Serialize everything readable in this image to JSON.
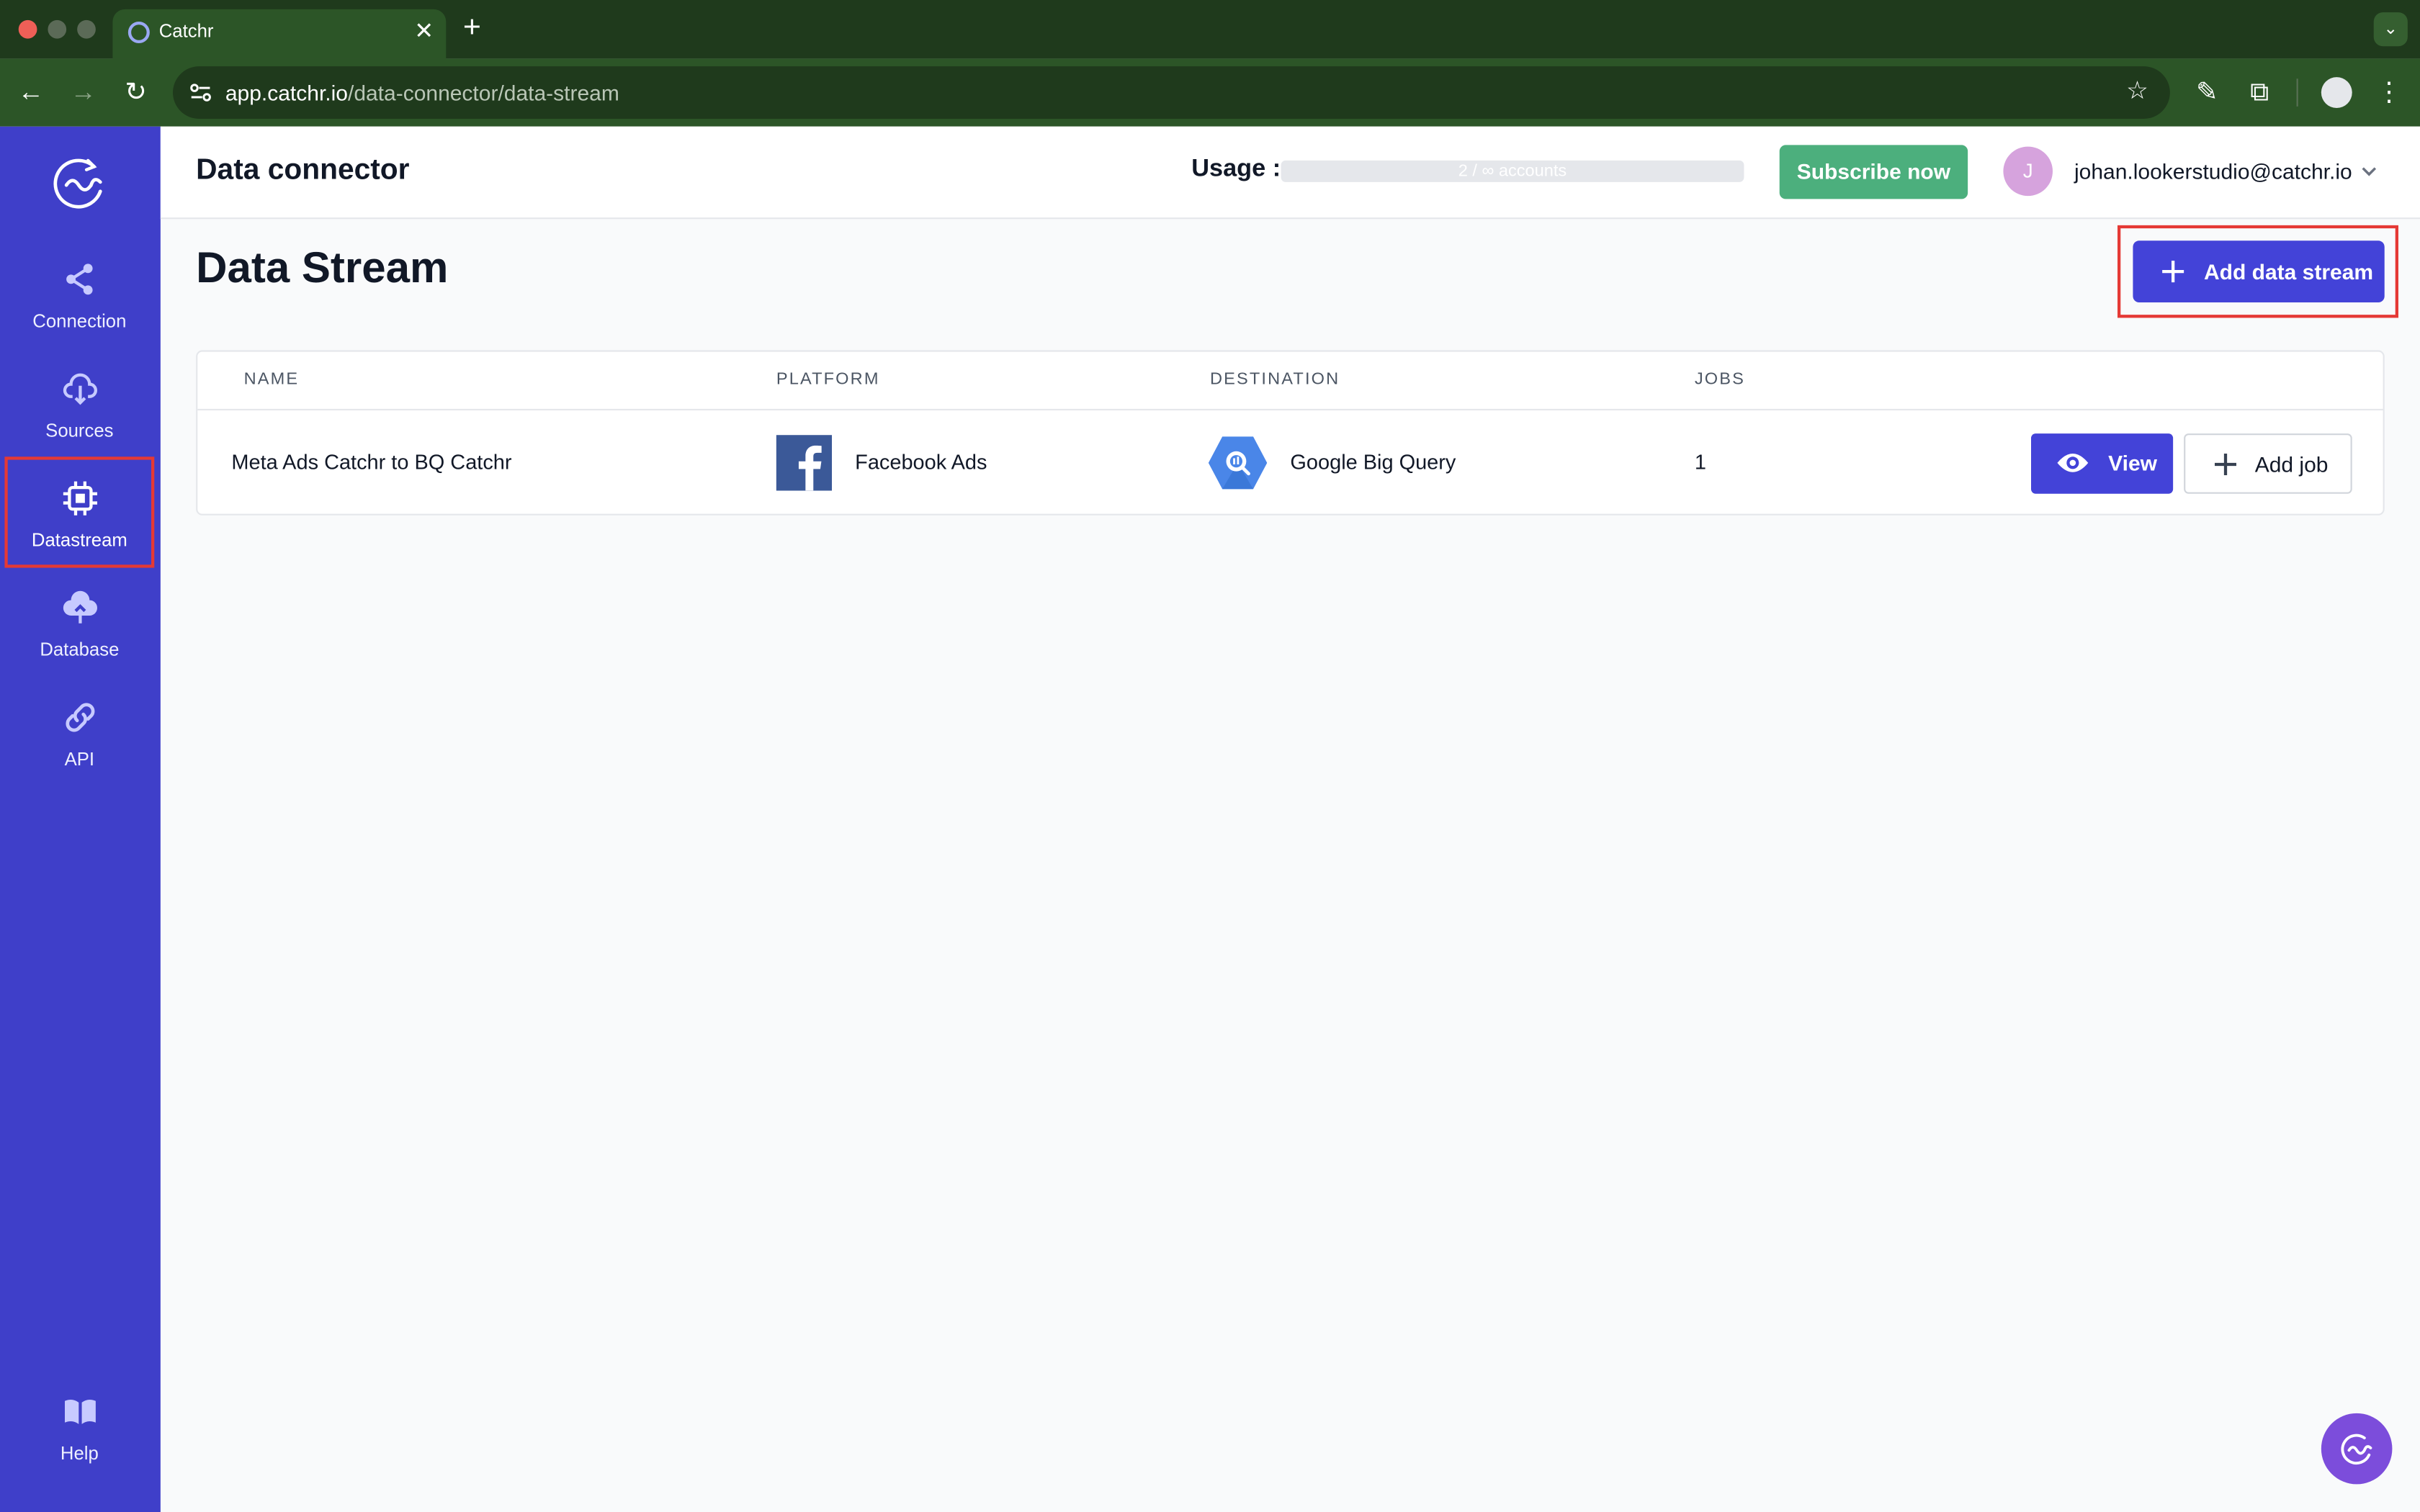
{
  "browser": {
    "tab_title": "Catchr",
    "tab_close": "✕",
    "new_tab": "+",
    "url_host": "app.catchr.io",
    "url_path": "/data-connector/data-stream",
    "icons": [
      "back-icon",
      "forward-icon",
      "reload-icon",
      "site-settings-icon",
      "star-icon",
      "pen-icon",
      "extension-icon",
      "profile-icon",
      "more-icon"
    ]
  },
  "sidebar": {
    "items": [
      {
        "label": "Connection",
        "icon": "share-icon"
      },
      {
        "label": "Sources",
        "icon": "cloud-download-icon"
      },
      {
        "label": "Datastream",
        "icon": "chip-icon",
        "active": true
      },
      {
        "label": "Database",
        "icon": "cloud-upload-icon"
      },
      {
        "label": "API",
        "icon": "link-icon"
      },
      {
        "label": "Help",
        "icon": "book-icon"
      }
    ]
  },
  "header": {
    "title": "Data connector",
    "usage_label": "Usage :",
    "usage_text": "2 / ∞ accounts",
    "subscribe_label": "Subscribe now",
    "avatar_initial": "J",
    "user_email": "johan.lookerstudio@catchr.io"
  },
  "main": {
    "page_title": "Data Stream",
    "add_button": "Add data stream",
    "table": {
      "columns": [
        "NAME",
        "PLATFORM",
        "DESTINATION",
        "JOBS"
      ],
      "rows": [
        {
          "name": "Meta Ads Catchr to BQ Catchr",
          "platform": "Facebook Ads",
          "destination": "Google Big Query",
          "jobs": "1",
          "view_label": "View",
          "add_job_label": "Add job"
        }
      ]
    }
  },
  "colors": {
    "sidebar": "#3f3fc9",
    "primary": "#4343d8",
    "subscribe": "#4caf7d",
    "highlight": "#e53935",
    "chrome": "#2c5527"
  }
}
